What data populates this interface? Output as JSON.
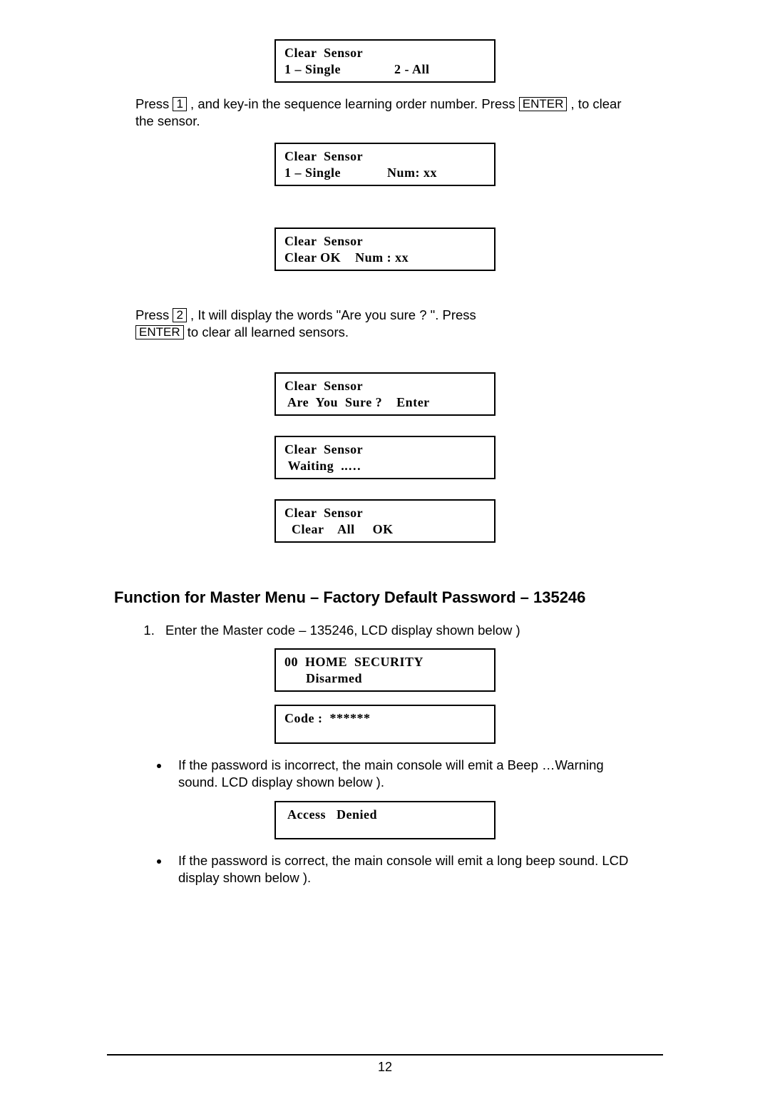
{
  "lcd1": {
    "l1": "Clear  Sensor",
    "l2": "1 – Single               2 - All"
  },
  "p1_a": "Press ",
  "p1_key1": "1",
  "p1_b": " , and key-in the sequence learning order number. Press ",
  "p1_key2": "ENTER",
  "p1_c": " , to clear the sensor.",
  "lcd2": {
    "l1": "Clear  Sensor",
    "l2": "1 – Single             Num: xx"
  },
  "lcd3": {
    "l1": "Clear  Sensor",
    "l2": "Clear OK    Num : xx"
  },
  "p2_a": "Press ",
  "p2_key1": "2",
  "p2_b": " , It will display the words \"Are you sure ? \". Press ",
  "p2_key2": "ENTER",
  "p2_c": " to clear all learned sensors.",
  "lcd4": {
    "l1": "Clear  Sensor",
    "l2": " Are  You  Sure ?    Enter"
  },
  "lcd5": {
    "l1": "Clear  Sensor",
    "l2": " Waiting  ..…"
  },
  "lcd6": {
    "l1": "Clear  Sensor",
    "l2": "  Clear    All     OK"
  },
  "heading": "Function for Master Menu – Factory Default Password – 135246",
  "step1": "Enter the Master code – 135246, LCD display shown below )",
  "lcd7": {
    "l1": "00  HOME  SECURITY",
    "l2": "      Disarmed"
  },
  "lcd8": {
    "l1": "Code :  ******",
    "l2": ""
  },
  "bullet1": "If the password is incorrect, the main console will emit a Beep …Warning sound. LCD display shown below ).",
  "lcd9": {
    "l1": " Access   Denied",
    "l2": ""
  },
  "bullet2": "If the password is correct, the main console will emit a long beep sound. LCD display shown below ).",
  "pagenum": "12"
}
